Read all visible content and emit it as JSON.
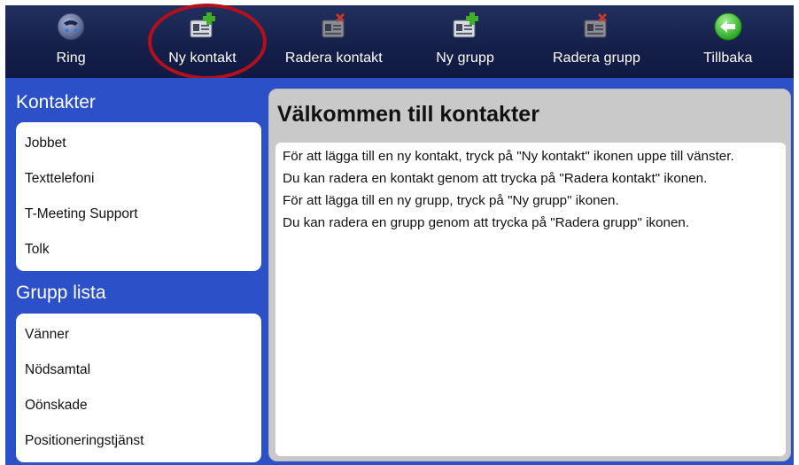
{
  "toolbar": {
    "buttons": [
      {
        "label": "Ring",
        "icon": "phone-globe-icon"
      },
      {
        "label": "Ny kontakt",
        "icon": "add-contact-icon"
      },
      {
        "label": "Radera kontakt",
        "icon": "delete-contact-icon"
      },
      {
        "label": "Ny grupp",
        "icon": "add-group-icon"
      },
      {
        "label": "Radera grupp",
        "icon": "delete-group-icon"
      },
      {
        "label": "Tillbaka",
        "icon": "back-arrow-icon"
      }
    ]
  },
  "contacts": {
    "title": "Kontakter",
    "items": [
      "Jobbet",
      "Texttelefoni",
      "T-Meeting Support",
      "Tolk"
    ]
  },
  "groups": {
    "title": "Grupp lista",
    "items": [
      "Vänner",
      "Nödsamtal",
      "Oönskade",
      "Positioneringstjänst"
    ]
  },
  "welcome": {
    "title": "Välkommen till kontakter",
    "paragraphs": [
      "För att lägga till en ny kontakt, tryck på \"Ny kontakt\" ikonen uppe till vänster.",
      "Du kan radera en kontakt genom att trycka på \"Radera kontakt\" ikonen.",
      "För att lägga till en ny grupp, tryck på \"Ny grupp\" ikonen.",
      "Du kan radera en grupp genom att trycka på \"Radera grupp\" ikonen."
    ]
  },
  "colors": {
    "toolbar": "#15204a",
    "background": "#2c50c8",
    "highlight_ring": "#b2111b",
    "add_mark": "#3fae2a",
    "delete_mark": "#c0392b",
    "back_button": "#2fb52b"
  }
}
